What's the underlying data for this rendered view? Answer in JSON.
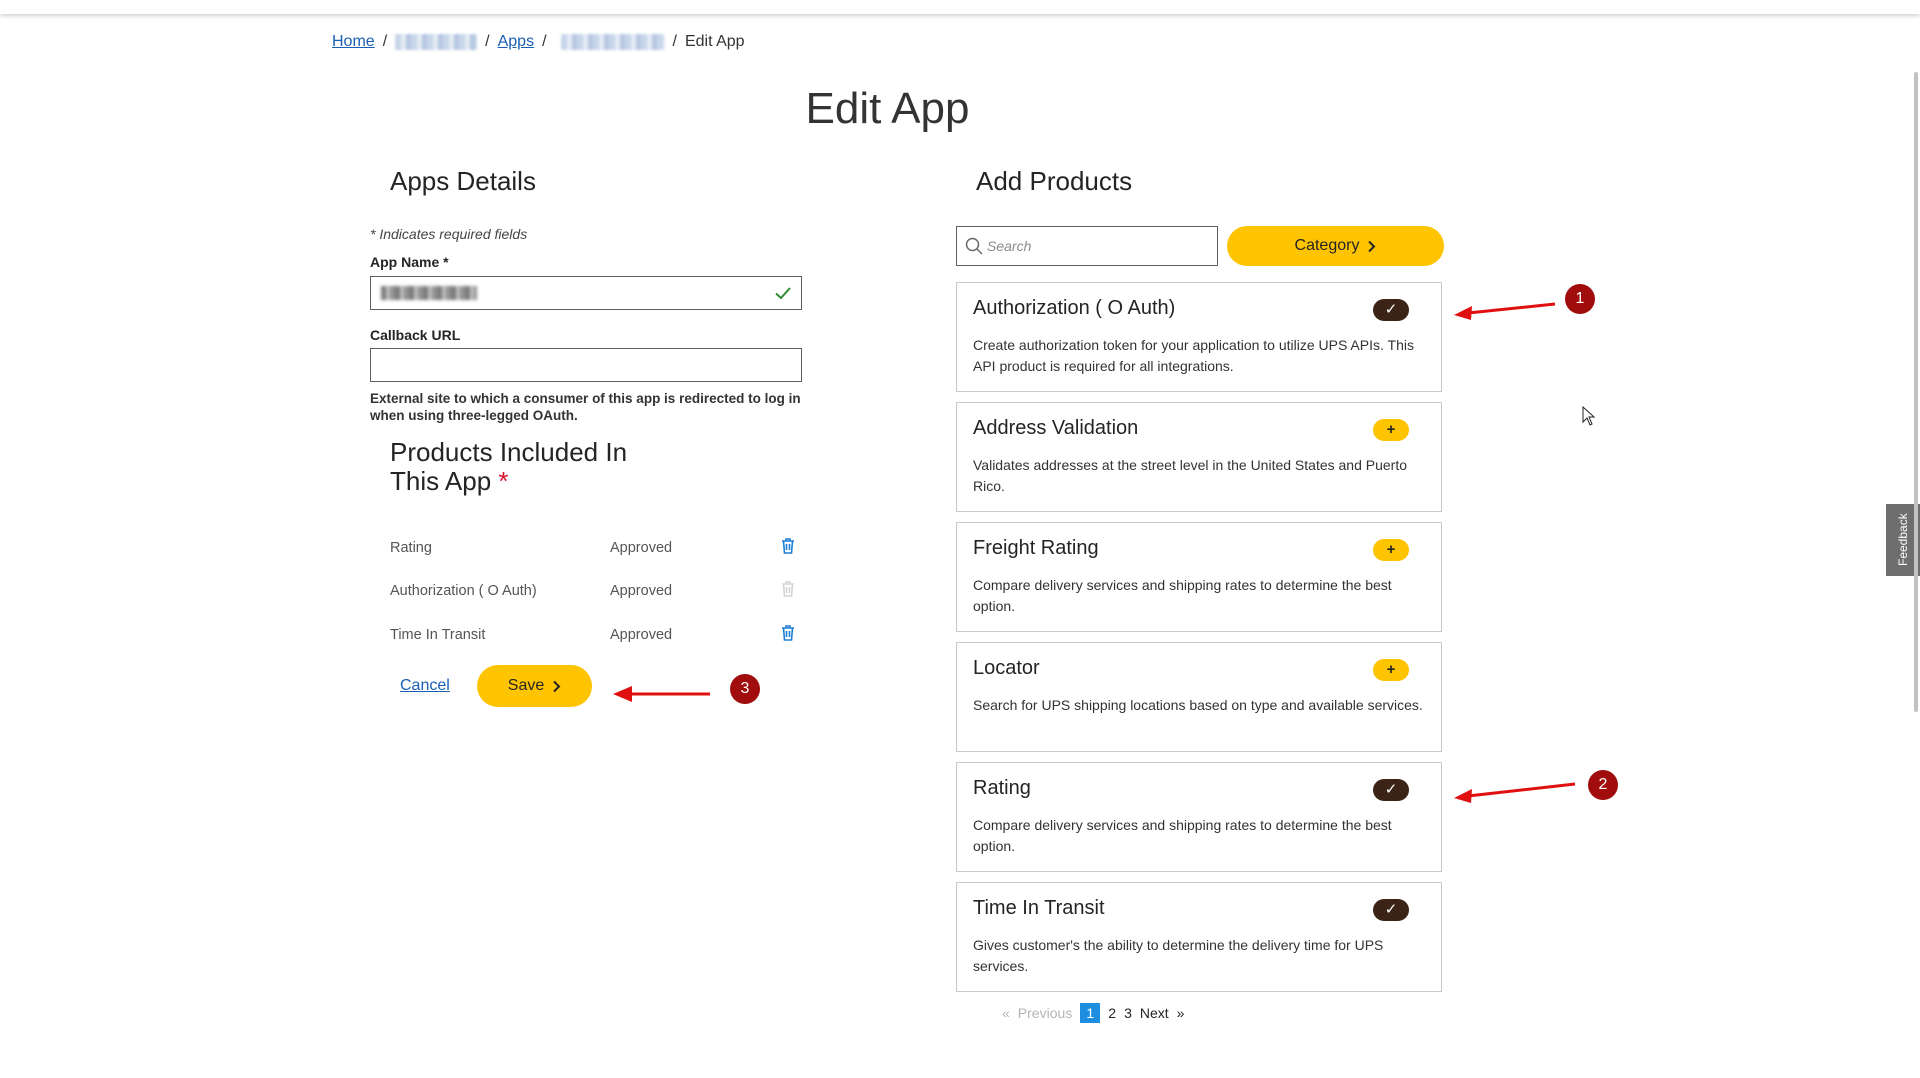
{
  "breadcrumb": {
    "home": "Home",
    "sep": "/",
    "apps": "Apps",
    "current": "Edit App"
  },
  "page": {
    "title": "Edit App"
  },
  "details": {
    "heading": "Apps Details",
    "required_note": "* Indicates required fields",
    "app_name_label": "App Name *",
    "callback_label": "Callback URL",
    "callback_value": "",
    "callback_helper": "External site to which a consumer of this app is redirected to log in when using three-legged OAuth."
  },
  "included": {
    "heading_line1": "Products Included In",
    "heading_line2": "This App",
    "required_star": "*",
    "rows": [
      {
        "name": "Rating",
        "status": "Approved"
      },
      {
        "name": "Authorization ( O Auth)",
        "status": "Approved"
      },
      {
        "name": "Time In Transit",
        "status": "Approved"
      }
    ],
    "cancel_label": "Cancel",
    "save_label": "Save"
  },
  "add_products": {
    "heading": "Add Products",
    "search_placeholder": "Search",
    "category_label": "Category",
    "cards": [
      {
        "title": "Authorization ( O Auth)",
        "desc": "Create authorization token for your application to utilize UPS APIs. This API product is required for all integrations.",
        "added": true,
        "glyph": "✓"
      },
      {
        "title": "Address Validation",
        "desc": "Validates addresses at the street level in the United States and Puerto Rico.",
        "added": false,
        "glyph": "+"
      },
      {
        "title": "Freight Rating",
        "desc": "Compare delivery services and shipping rates to determine the best option.",
        "added": false,
        "glyph": "+"
      },
      {
        "title": "Locator",
        "desc": "Search for UPS shipping locations based on type and available services.",
        "added": false,
        "glyph": "+"
      },
      {
        "title": "Rating",
        "desc": "Compare delivery services and shipping rates to determine the best option.",
        "added": true,
        "glyph": "✓"
      },
      {
        "title": "Time In Transit",
        "desc": "Gives customer's the ability to determine the delivery time for UPS services.",
        "added": true,
        "glyph": "✓"
      }
    ]
  },
  "pagination": {
    "prev": "Previous",
    "prev_glyph": "«",
    "pages": [
      "1",
      "2",
      "3"
    ],
    "next": "Next",
    "next_glyph": "»"
  },
  "annotations": {
    "badge1": "1",
    "badge2": "2",
    "badge3": "3"
  },
  "feedback": {
    "label": "Feedback"
  },
  "colors": {
    "accent": "#ffc400",
    "toggle_on": "#3b2415",
    "link": "#1a5fb4",
    "annotation": "#a10d0d",
    "arrow": "#e01010"
  },
  "icons": {
    "search": "search-icon",
    "trash": "trash-icon",
    "check": "check-icon",
    "chevron": "chevron-right-icon"
  }
}
